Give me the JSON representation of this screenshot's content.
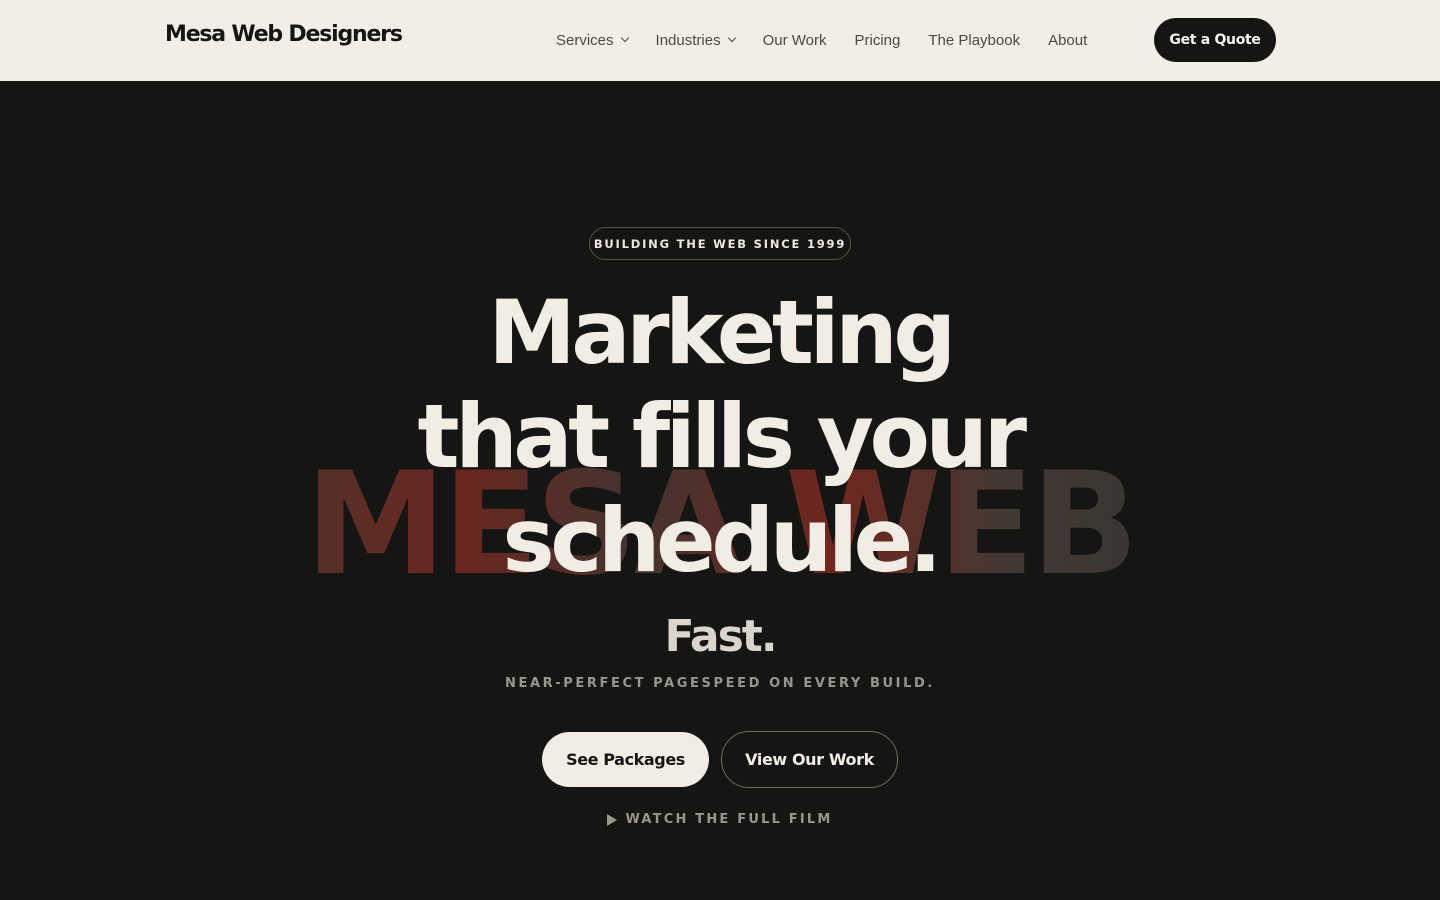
{
  "nav": {
    "logo": "Mesa Web Designers",
    "links": [
      {
        "label": "Services"
      },
      {
        "label": "Industries"
      },
      {
        "label": "Our Work"
      },
      {
        "label": "Pricing"
      },
      {
        "label": "The Playbook"
      },
      {
        "label": "About"
      }
    ],
    "cta_label": "Get a Quote"
  },
  "hero": {
    "badge": "BUILDING THE WEB SINCE 1999",
    "headline_lines": [
      "Marketing",
      "that fills your",
      "schedule."
    ],
    "background_word": "MESA WEB",
    "fast": "Fast.",
    "subline": "NEAR-PERFECT PAGESPEED ON EVERY BUILD.",
    "primary_button": "See Packages",
    "secondary_button": "View Our Work",
    "film_link": "WATCH THE FULL FILM"
  },
  "colors": {
    "nav_background": "#f1eee7",
    "hero_background": "#151513",
    "text_light": "#f1ede4",
    "accent_red": "#7a2a22"
  },
  "icons": [
    "chevron-down-icon",
    "play-icon"
  ]
}
